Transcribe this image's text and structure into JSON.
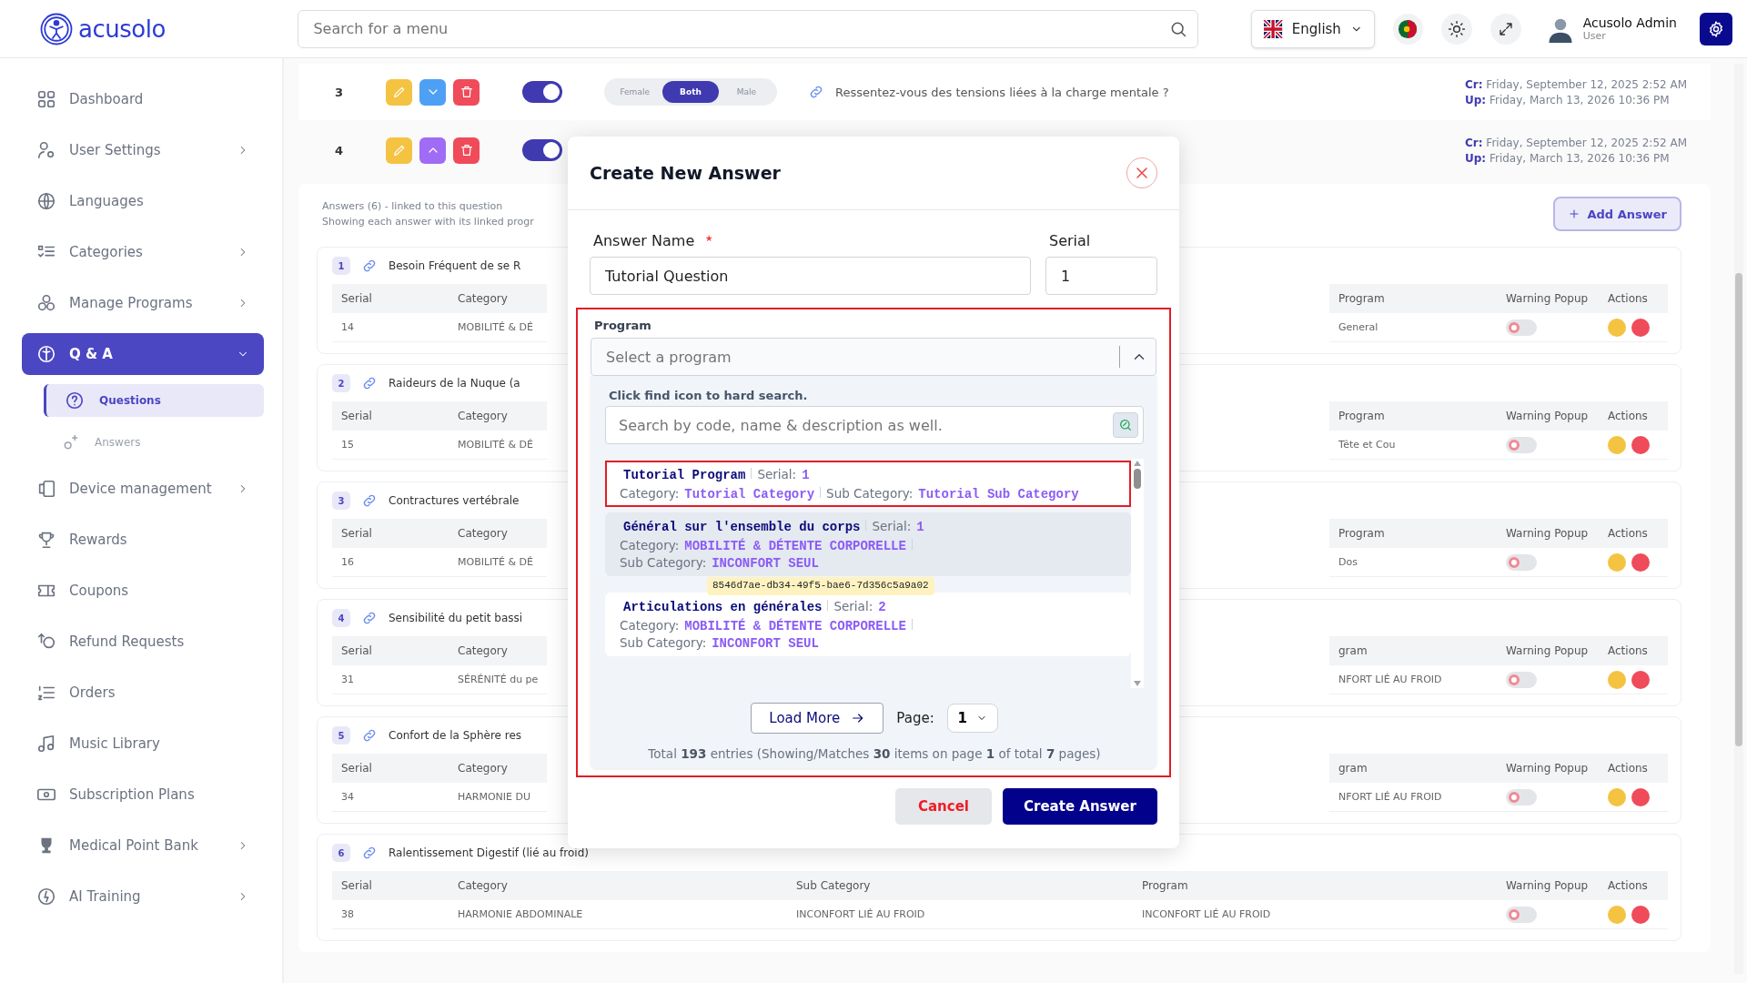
{
  "header": {
    "logo": "acusolo",
    "search_placeholder": "Search for a menu",
    "language": "English",
    "user_name": "Acusolo Admin",
    "user_role": "User"
  },
  "sidebar": {
    "items": [
      {
        "label": "Dashboard",
        "expandable": false,
        "selected": false
      },
      {
        "label": "User Settings",
        "expandable": true,
        "expanded": false,
        "selected": false
      },
      {
        "label": "Languages",
        "expandable": false,
        "selected": false
      },
      {
        "label": "Categories",
        "expandable": true,
        "expanded": false,
        "selected": false
      },
      {
        "label": "Manage Programs",
        "expandable": true,
        "expanded": false,
        "selected": false
      },
      {
        "label": "Q & A",
        "expandable": true,
        "expanded": true,
        "selected": true,
        "children": [
          {
            "label": "Questions",
            "selected": true
          },
          {
            "label": "Answers",
            "selected": false
          }
        ]
      },
      {
        "label": "Device management",
        "expandable": true,
        "expanded": false,
        "selected": false
      },
      {
        "label": "Rewards",
        "expandable": false,
        "selected": false
      },
      {
        "label": "Coupons",
        "expandable": false,
        "selected": false
      },
      {
        "label": "Refund Requests",
        "expandable": false,
        "selected": false
      },
      {
        "label": "Orders",
        "expandable": false,
        "selected": false
      },
      {
        "label": "Music Library",
        "expandable": false,
        "selected": false
      },
      {
        "label": "Subscription Plans",
        "expandable": false,
        "selected": false
      },
      {
        "label": "Medical Point Bank",
        "expandable": true,
        "expanded": false,
        "selected": false
      },
      {
        "label": "AI Training",
        "expandable": true,
        "expanded": false,
        "selected": false
      }
    ]
  },
  "questions": [
    {
      "number": "3",
      "expanded": false,
      "on": true,
      "genders": [
        {
          "label": "Female",
          "selected": false
        },
        {
          "label": "Both",
          "selected": true
        },
        {
          "label": "Male",
          "selected": false
        }
      ],
      "text": "Ressentez-vous des tensions liées à la charge mentale ?",
      "created_label": "Cr:",
      "created": "Friday, September 12, 2025 2:52 AM",
      "updated_label": "Up:",
      "updated": "Friday, March 13, 2026 10:36 PM"
    },
    {
      "number": "4",
      "expanded": true,
      "on": true,
      "created_label": "Cr:",
      "created": "Friday, September 12, 2025 2:52 AM",
      "updated_label": "Up:",
      "updated": "Friday, March 13, 2026 10:36 PM"
    }
  ],
  "answers_panel": {
    "summary": "Answers (6) - linked to this question",
    "note": "Showing each answer with its linked progr",
    "add_button": "Add Answer",
    "cards": [
      {
        "number": "1",
        "title": "Besoin Fréquent de se R",
        "left": [
          {
            "kind": "text",
            "header": "Serial",
            "value": "14"
          },
          {
            "kind": "text",
            "header": "Category",
            "value": "MOBILITÉ & DÉ"
          }
        ],
        "right": [
          {
            "kind": "text",
            "header": "Program",
            "value": "General"
          },
          {
            "kind": "toggle",
            "header": "Warning Popup",
            "on": false
          },
          {
            "kind": "actions",
            "header": "Actions"
          }
        ]
      },
      {
        "number": "2",
        "title": "Raideurs de la Nuque (a",
        "left": [
          {
            "kind": "text",
            "header": "Serial",
            "value": "15"
          },
          {
            "kind": "text",
            "header": "Category",
            "value": "MOBILITÉ & DÉ"
          }
        ],
        "right": [
          {
            "kind": "text",
            "header": "Program",
            "value": "Tête et Cou"
          },
          {
            "kind": "toggle",
            "header": "Warning Popup",
            "on": false
          },
          {
            "kind": "actions",
            "header": "Actions"
          }
        ]
      },
      {
        "number": "3",
        "title": "Contractures vertébrale",
        "left": [
          {
            "kind": "text",
            "header": "Serial",
            "value": "16"
          },
          {
            "kind": "text",
            "header": "Category",
            "value": "MOBILITÉ & DÉ"
          }
        ],
        "right": [
          {
            "kind": "text",
            "header": "Program",
            "value": "Dos"
          },
          {
            "kind": "toggle",
            "header": "Warning Popup",
            "on": false
          },
          {
            "kind": "actions",
            "header": "Actions"
          }
        ]
      },
      {
        "number": "4",
        "title": "Sensibilité du petit bassi",
        "left": [
          {
            "kind": "text",
            "header": "Serial",
            "value": "31"
          },
          {
            "kind": "text",
            "header": "Category",
            "value": "SÉRÉNITÉ du pe"
          }
        ],
        "right": [
          {
            "kind": "text",
            "header": "gram",
            "value": "NFORT LIÉ AU FROID"
          },
          {
            "kind": "toggle",
            "header": "Warning Popup",
            "on": false
          },
          {
            "kind": "actions",
            "header": "Actions"
          }
        ]
      },
      {
        "number": "5",
        "title": "Confort de la Sphère res",
        "left": [
          {
            "kind": "text",
            "header": "Serial",
            "value": "34"
          },
          {
            "kind": "text",
            "header": "Category",
            "value": "HARMONIE DU"
          }
        ],
        "right": [
          {
            "kind": "text",
            "header": "gram",
            "value": "NFORT LIÉ AU FROID"
          },
          {
            "kind": "toggle",
            "header": "Warning Popup",
            "on": false
          },
          {
            "kind": "actions",
            "header": "Actions"
          }
        ]
      },
      {
        "number": "6",
        "title": "Ralentissement Digestif (lié au froid)",
        "left": [
          {
            "kind": "text",
            "header": "Serial",
            "value": "38"
          },
          {
            "kind": "text",
            "header": "Category",
            "value": "HARMONIE ABDOMINALE"
          },
          {
            "kind": "text",
            "header": "Sub Category",
            "value": "INCONFORT LIÉ AU FROID"
          },
          {
            "kind": "text",
            "header": "Program",
            "value": "INCONFORT LIÉ AU FROID"
          }
        ],
        "right": [
          {
            "kind": "toggle",
            "header": "Warning Popup",
            "on": false
          },
          {
            "kind": "actions",
            "header": "Actions"
          }
        ]
      }
    ]
  },
  "modal": {
    "title": "Create New Answer",
    "answer_name": {
      "label": "Answer Name",
      "required": true,
      "value": "Tutorial Question"
    },
    "serial": {
      "label": "Serial",
      "value": "1"
    },
    "program": {
      "label": "Program",
      "highlighted": true,
      "placeholder": "Select a program",
      "open": true,
      "hint": "Click find icon to hard search.",
      "search_placeholder": "Search by code, name & description as well.",
      "options": [
        {
          "name": "Tutorial Program",
          "serial_label": "Serial:",
          "serial": "1",
          "category_label": "Category:",
          "category": "Tutorial Category",
          "sub_category_label": "Sub Category:",
          "sub_category": "Tutorial Sub Category",
          "highlighted": true,
          "hovered": false
        },
        {
          "name": "Général sur l'ensemble du corps",
          "serial_label": "Serial:",
          "serial": "1",
          "category_label": "Category:",
          "category": "MOBILITÉ & DÉTENTE CORPORELLE",
          "sub_category_label": "Sub Category:",
          "sub_category": "INCONFORT SEUL",
          "highlighted": false,
          "hovered": true
        },
        {
          "name": "Articulations en générales",
          "serial_label": "Serial:",
          "serial": "2",
          "category_label": "Category:",
          "category": "MOBILITÉ & DÉTENTE CORPORELLE",
          "sub_category_label": "Sub Category:",
          "sub_category": "INCONFORT SEUL",
          "highlighted": false,
          "hovered": false
        }
      ],
      "tooltip": "8546d7ae-db34-49f5-bae6-7d356c5a9a02",
      "load_more": "Load More",
      "page_label": "Page:",
      "page": "1",
      "total": "Total **193** entries (Showing/Matches **30** items on page **1** of total **7** pages)"
    },
    "cancel": "Cancel",
    "submit": "Create Answer"
  }
}
